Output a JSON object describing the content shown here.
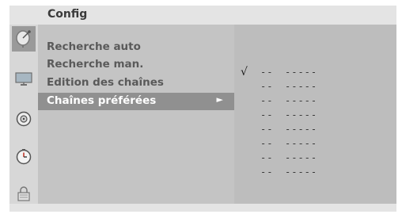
{
  "window": {
    "title": "Config"
  },
  "menu": {
    "items": [
      {
        "label": "Recherche auto"
      },
      {
        "label": "Recherche man."
      },
      {
        "label": "Edition des chaînes"
      },
      {
        "label": "Chaînes préférées",
        "arrow": "►",
        "selected": true
      }
    ]
  },
  "channels": [
    {
      "check": "√",
      "number": "--",
      "name": "-----"
    },
    {
      "check": "",
      "number": "--",
      "name": "-----"
    },
    {
      "check": "",
      "number": "--",
      "name": "-----"
    },
    {
      "check": "",
      "number": "--",
      "name": "-----"
    },
    {
      "check": "",
      "number": "--",
      "name": "-----"
    },
    {
      "check": "",
      "number": "--",
      "name": "-----"
    },
    {
      "check": "",
      "number": "--",
      "name": "-----"
    },
    {
      "check": "",
      "number": "--",
      "name": "-----"
    }
  ],
  "icons": [
    "satellite-dish-icon",
    "tv-screen-icon",
    "speaker-icon",
    "clock-icon",
    "lock-icon"
  ],
  "colors": {
    "selected_background": "#909090",
    "panel_background": "#c4c4c4",
    "list_background": "#bdbdbd"
  }
}
